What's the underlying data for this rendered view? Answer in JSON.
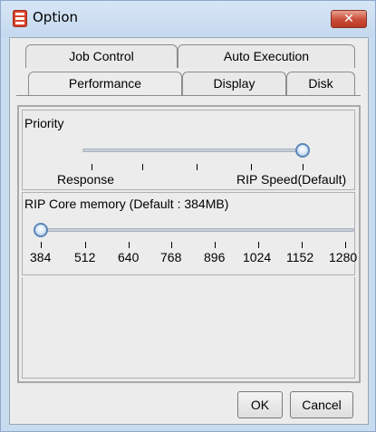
{
  "window": {
    "title": "Option",
    "icon": "app-icon",
    "close_label": "✕"
  },
  "tabs": {
    "row1": [
      {
        "label": "Job Control"
      },
      {
        "label": "Auto Execution"
      }
    ],
    "row2": [
      {
        "label": "Performance",
        "active": true
      },
      {
        "label": "Display"
      },
      {
        "label": "Disk"
      }
    ]
  },
  "priority": {
    "title": "Priority",
    "left_label": "Response",
    "right_label": "RIP Speed(Default)",
    "level_fraction": 1.0
  },
  "memory": {
    "title": "RIP Core memory (Default : 384MB)",
    "ticks": [
      "384",
      "512",
      "640",
      "768",
      "896",
      "1024",
      "1152",
      "1280"
    ],
    "selected": "384"
  },
  "buttons": {
    "ok": "OK",
    "cancel": "Cancel"
  },
  "colors": {
    "accent": "#5b86b8",
    "close": "#c94c36"
  }
}
